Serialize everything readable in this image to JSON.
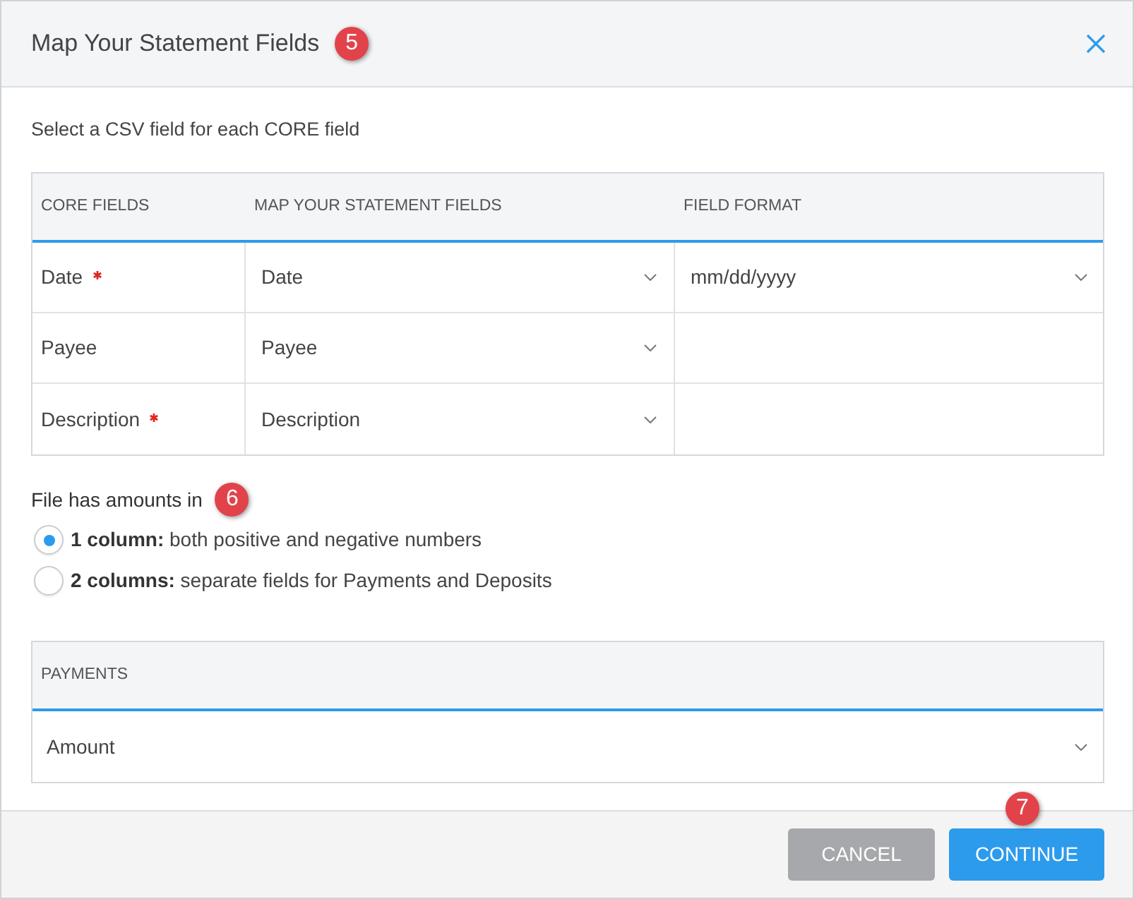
{
  "dialog": {
    "title": "Map Your Statement Fields",
    "step_badge": "5"
  },
  "instructions": "Select a CSV field for each CORE field",
  "mapping_table": {
    "columns": [
      "CORE FIELDS",
      "MAP YOUR STATEMENT FIELDS",
      "FIELD FORMAT"
    ],
    "rows": [
      {
        "core_field": "Date",
        "required": true,
        "statement_field": "Date",
        "field_format": "mm/dd/yyyy"
      },
      {
        "core_field": "Payee",
        "required": false,
        "statement_field": "Payee"
      },
      {
        "core_field": "Description",
        "required": true,
        "statement_field": "Description"
      }
    ]
  },
  "amounts": {
    "label": "File has amounts in",
    "step_badge": "6",
    "options": [
      {
        "label": "**1 column:** both positive and negative numbers",
        "selected": true
      },
      {
        "label": "**2 columns:** separate fields for Payments and Deposits",
        "selected": false
      }
    ]
  },
  "payments_table": {
    "columns": [
      "PAYMENTS"
    ],
    "rows": [
      {
        "value": "Amount"
      }
    ]
  },
  "footer": {
    "buttons": [
      {
        "label": "CANCEL",
        "kind": "secondary"
      },
      {
        "label": "CONTINUE",
        "kind": "primary",
        "step_badge": "7"
      }
    ]
  }
}
